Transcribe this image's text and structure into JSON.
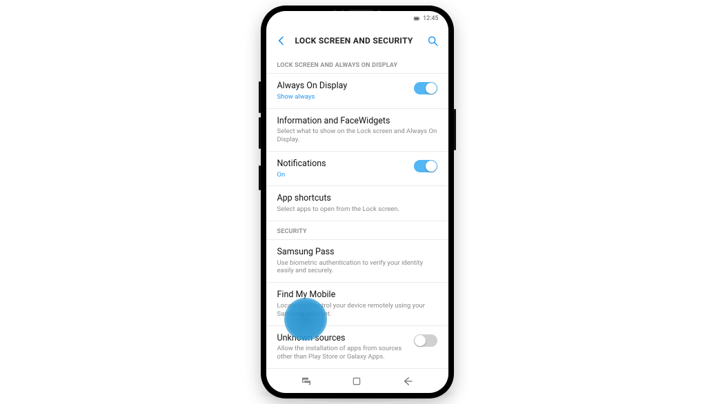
{
  "status": {
    "time": "12:45"
  },
  "header": {
    "title": "LOCK SCREEN AND SECURITY"
  },
  "sections": {
    "lockscreen": {
      "label": "LOCK SCREEN AND ALWAYS ON DISPLAY",
      "aod": {
        "title": "Always On Display",
        "sub": "Show always",
        "on": true
      },
      "facewidgets": {
        "title": "Information and FaceWidgets",
        "sub": "Select what to show on the Lock screen and Always On Display."
      },
      "notifications": {
        "title": "Notifications",
        "sub": "On",
        "on": true
      },
      "shortcuts": {
        "title": "App shortcuts",
        "sub": "Select apps to open from the Lock screen."
      }
    },
    "security": {
      "label": "SECURITY",
      "pass": {
        "title": "Samsung Pass",
        "sub": "Use biometric authentication to verify your identity easily and securely."
      },
      "findmy": {
        "title": "Find My Mobile",
        "sub": "Locate and control your device remotely using your Samsung account."
      },
      "unknown": {
        "title": "Unknown sources",
        "sub": "Allow the installation of apps from sources other than Play Store or Galaxy Apps.",
        "on": false
      }
    }
  }
}
